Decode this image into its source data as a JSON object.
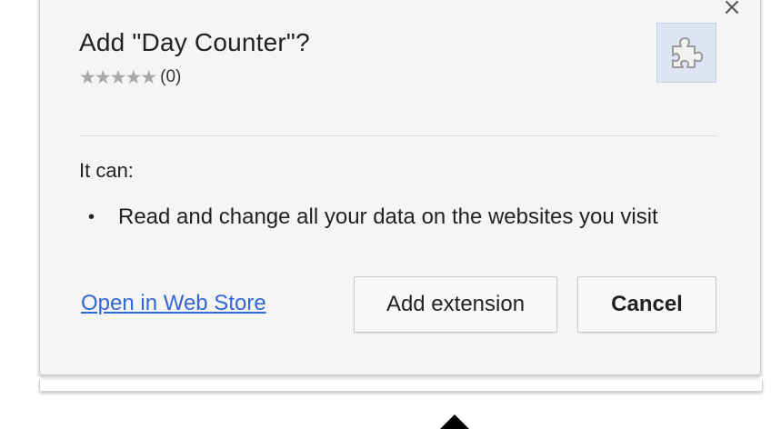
{
  "dialog": {
    "title": "Add \"Day Counter\"?",
    "close_glyph": "×",
    "rating": {
      "stars": "★★★★★",
      "value": 0,
      "count_text": "(0)",
      "star_color": "#a8a8a8"
    },
    "icon": "puzzle-piece-icon",
    "permissions_header": "It can:",
    "permissions": [
      "Read and change all your data on the websites you visit"
    ],
    "bullet": "•",
    "store_link": "Open in Web Store",
    "add_button": "Add extension",
    "cancel_button": "Cancel"
  },
  "colors": {
    "link": "#3367d6",
    "dialog_bg": "#f5f5f5",
    "icon_bg": "#dde5f4"
  }
}
